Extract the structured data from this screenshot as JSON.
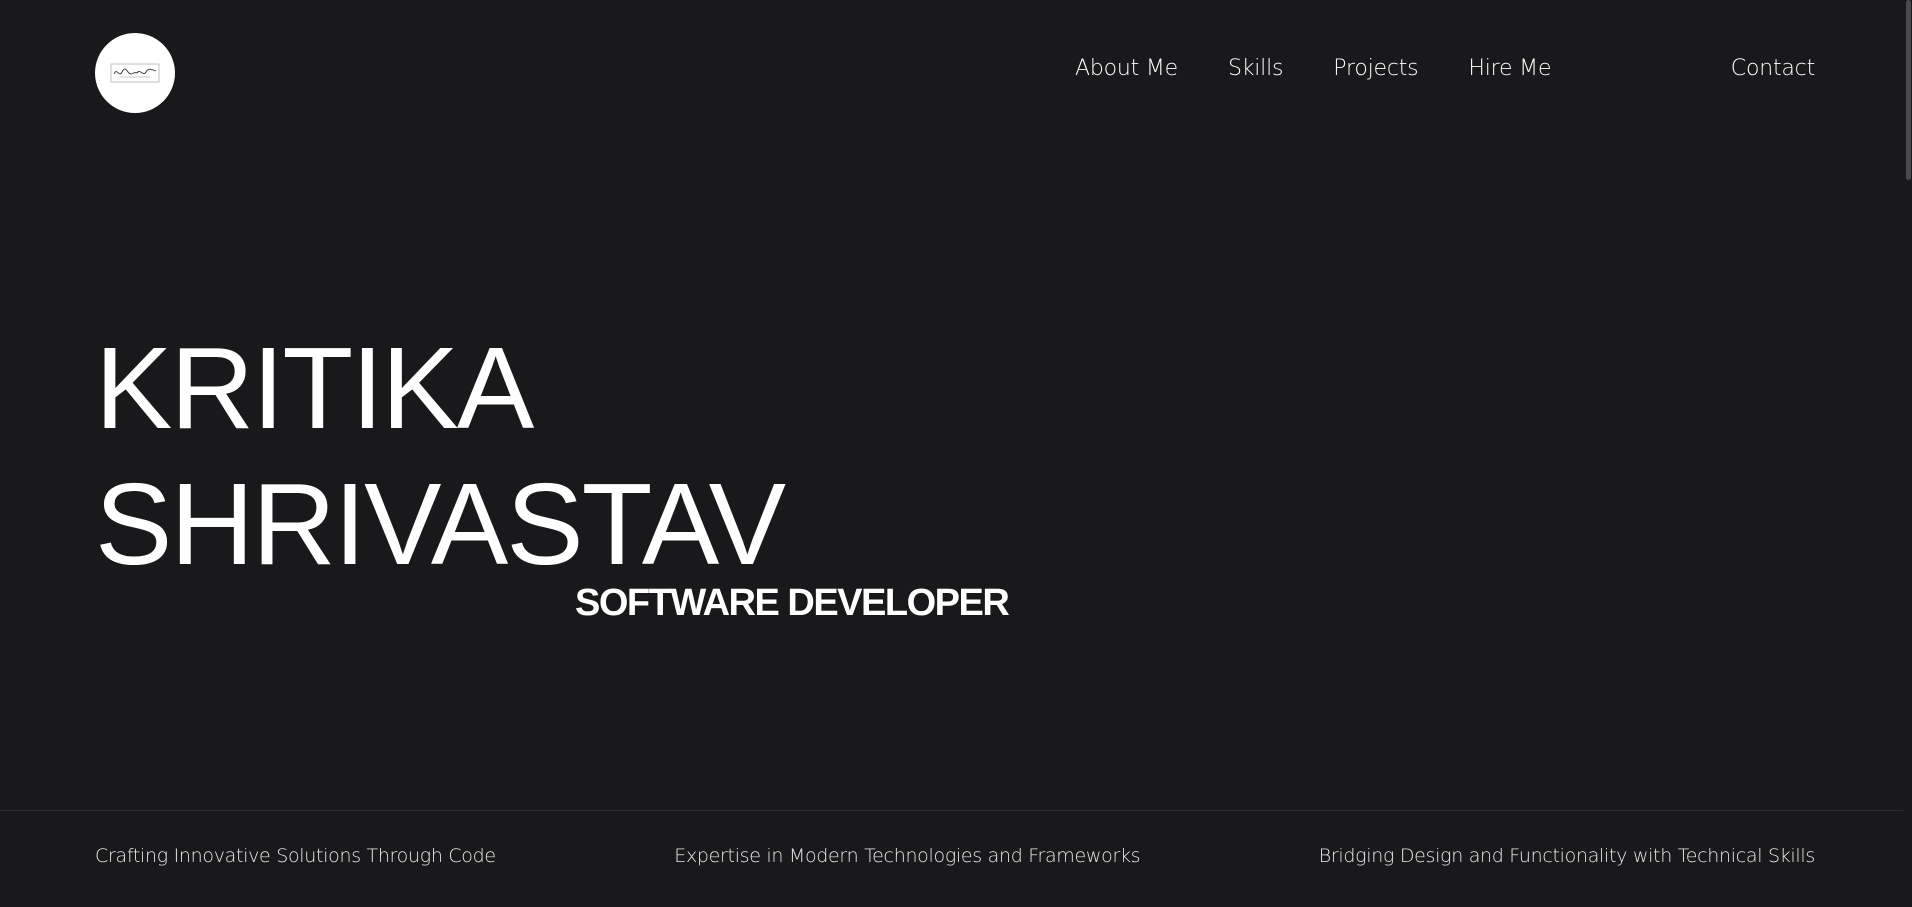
{
  "header": {
    "nav": [
      {
        "label": "About Me"
      },
      {
        "label": "Skills"
      },
      {
        "label": "Projects"
      },
      {
        "label": "Hire Me"
      }
    ],
    "contact_label": "Contact"
  },
  "hero": {
    "first_name": "KRITIKA",
    "last_name": "SHRIVASTAV",
    "role": "SOFTWARE DEVELOPER"
  },
  "taglines": [
    "Crafting Innovative Solutions Through Code",
    "Expertise in Modern Technologies and Frameworks",
    "Bridging Design and Functionality with Technical Skills"
  ],
  "colors": {
    "background": "#19191b",
    "text": "#ffffff",
    "logo_bg": "#ffffff"
  },
  "icons": {
    "logo": "signature-logo-icon"
  }
}
